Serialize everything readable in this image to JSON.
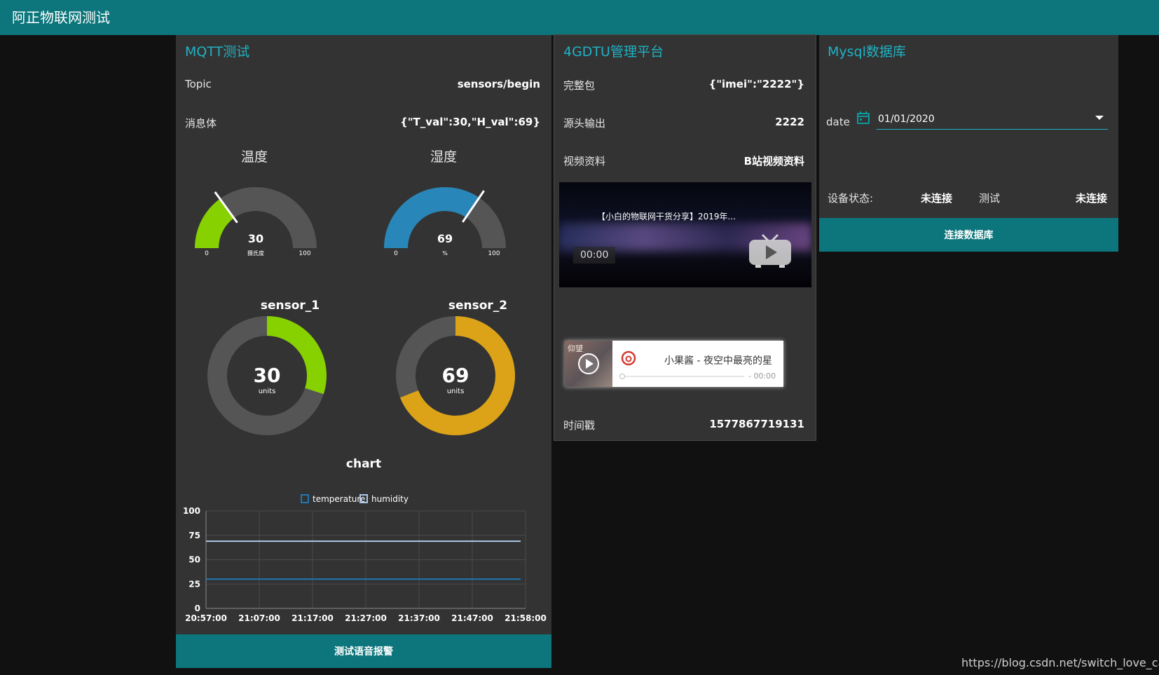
{
  "app": {
    "title": "阿正物联网测试"
  },
  "mqtt": {
    "title": "MQTT测试",
    "topic_label": "Topic",
    "topic_value": "sensors/begin",
    "body_label": "消息体",
    "body_value": "{\"T_val\":30,\"H_val\":69}",
    "gauges": [
      {
        "title": "温度",
        "value": 30,
        "unit": "摄氏度",
        "min": 0,
        "max": 100,
        "color": "#87d100"
      },
      {
        "title": "湿度",
        "value": 69,
        "unit": "%",
        "min": 0,
        "max": 100,
        "color": "#2986b8"
      }
    ],
    "donuts": [
      {
        "title": "sensor_1",
        "value": 30,
        "unit": "units",
        "max": 100,
        "color": "#87d100"
      },
      {
        "title": "sensor_2",
        "value": 69,
        "unit": "units",
        "max": 100,
        "color": "#dca318"
      }
    ],
    "button_label": "测试语音报警"
  },
  "chart_data": {
    "type": "line",
    "title": "chart",
    "x": [
      "20:57:00",
      "21:07:00",
      "21:17:00",
      "21:27:00",
      "21:37:00",
      "21:47:00",
      "21:58:00"
    ],
    "ylim": [
      0,
      100
    ],
    "yticks": [
      0,
      25,
      50,
      75,
      100
    ],
    "grid": true,
    "legend": "top",
    "series": [
      {
        "name": "temperature",
        "color": "#1f77b4",
        "values": [
          30,
          30,
          30,
          30,
          30,
          30,
          30
        ]
      },
      {
        "name": "humidity",
        "color": "#aec7e8",
        "values": [
          69,
          69,
          69,
          69,
          69,
          69,
          69
        ]
      }
    ]
  },
  "dtu": {
    "title": "4GDTU管理平台",
    "rows": [
      {
        "label": "完整包",
        "value": "{\"imei\":\"2222\"}"
      },
      {
        "label": "源头输出",
        "value": "2222"
      },
      {
        "label": "视频资料",
        "value": "B站视频资料"
      }
    ],
    "video": {
      "title": "【小白的物联网干货分享】2019年...",
      "time": "00:00"
    },
    "music": {
      "cover_text": "仰望",
      "song": "小果酱 - 夜空中最亮的星",
      "time": "- 00:00"
    },
    "timestamp_label": "时间戳",
    "timestamp_value": "1577867719131"
  },
  "mysql": {
    "title": "Mysql数据库",
    "date_label": "date",
    "date_value": "01/01/2020",
    "status_label": "设备状态:",
    "status_value": "未连接",
    "test_label": "测试",
    "test_value": "未连接",
    "button_label": "连接数据库"
  },
  "watermark": "https://blog.csdn.net/switch_love_case"
}
